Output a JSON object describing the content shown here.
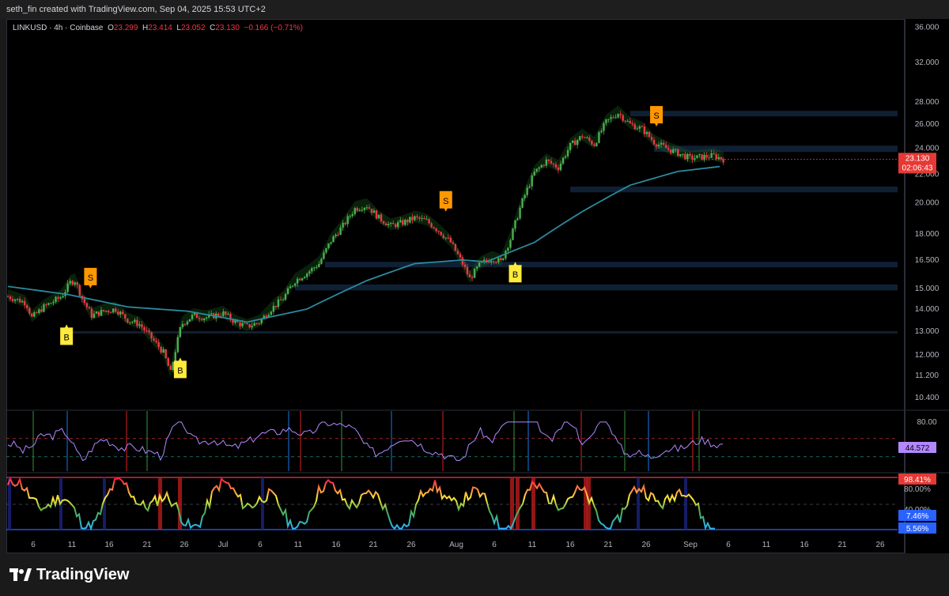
{
  "header": {
    "attribution": "seth_fin created with TradingView.com, Sep 04, 2025 15:53 UTC+2"
  },
  "legend": {
    "symbol": "LINKUSD · 4h · Coinbase",
    "o_label": "O",
    "o_value": "23.299",
    "h_label": "H",
    "h_value": "23.414",
    "l_label": "L",
    "l_value": "23.052",
    "c_label": "C",
    "c_value": "23.130",
    "change": "−0.166 (−0.71%)"
  },
  "price_badge": {
    "price": "23.130",
    "countdown": "02:06:43"
  },
  "rsi_badge": "44.572",
  "osc_badges": [
    "98.41%",
    "7.46%",
    "5.56%"
  ],
  "footer": {
    "brand": "TradingView"
  },
  "colors": {
    "up": "#26a69a",
    "up_bright": "#4caf50",
    "down": "#f23645",
    "ema": "#2b8a9e",
    "buy_badge": "#ffeb3b",
    "sell_badge": "#ff9800",
    "rsi": "#b388ff",
    "zone": "#1e3a5f"
  },
  "chart_data": {
    "type": "candlestick",
    "symbol": "LINKUSD",
    "timeframe": "4h",
    "exchange": "Coinbase",
    "price_axis": {
      "scale": "log",
      "ticks": [
        "36.000",
        "32.000",
        "28.000",
        "26.000",
        "24.000",
        "22.000",
        "20.000",
        "18.000",
        "16.500",
        "15.000",
        "14.000",
        "13.000",
        "12.000",
        "11.200",
        "10.400"
      ]
    },
    "x_ticks": [
      "6",
      "11",
      "16",
      "21",
      "26",
      "Jul",
      "6",
      "11",
      "16",
      "21",
      "26",
      "Aug",
      "6",
      "11",
      "16",
      "21",
      "26",
      "Sep",
      "6",
      "11",
      "16",
      "21",
      "26"
    ],
    "price_path": [
      [
        0,
        14.6
      ],
      [
        1.5,
        14.3
      ],
      [
        2,
        13.6
      ],
      [
        3,
        14.1
      ],
      [
        4.5,
        14.6
      ],
      [
        5.2,
        15.3
      ],
      [
        5.6,
        15.4
      ],
      [
        6.2,
        14.5
      ],
      [
        7,
        13.7
      ],
      [
        8,
        13.9
      ],
      [
        9,
        14.0
      ],
      [
        10,
        13.5
      ],
      [
        11,
        13.3
      ],
      [
        12,
        12.7
      ],
      [
        13,
        12.1
      ],
      [
        13.6,
        11.3
      ],
      [
        14.5,
        13.3
      ],
      [
        15.5,
        13.7
      ],
      [
        16.5,
        13.6
      ],
      [
        18,
        13.8
      ],
      [
        19,
        13.4
      ],
      [
        20,
        13.2
      ],
      [
        21,
        13.4
      ],
      [
        22,
        14.0
      ],
      [
        23,
        14.5
      ],
      [
        24,
        15.4
      ],
      [
        25,
        15.8
      ],
      [
        26,
        16.3
      ],
      [
        27,
        17.6
      ],
      [
        28,
        18.5
      ],
      [
        29,
        19.6
      ],
      [
        30,
        19.8
      ],
      [
        31,
        19.0
      ],
      [
        32,
        18.5
      ],
      [
        33,
        18.7
      ],
      [
        34,
        19.0
      ],
      [
        35,
        18.8
      ],
      [
        36,
        18.2
      ],
      [
        37,
        17.5
      ],
      [
        38,
        16.3
      ],
      [
        38.6,
        15.5
      ],
      [
        39.5,
        16.3
      ],
      [
        40.5,
        16.6
      ],
      [
        41.2,
        16.4
      ],
      [
        42,
        17.7
      ],
      [
        43,
        20.1
      ],
      [
        44,
        22.1
      ],
      [
        45,
        23.0
      ],
      [
        46,
        22.5
      ],
      [
        47,
        24.2
      ],
      [
        48,
        25.0
      ],
      [
        49,
        24.3
      ],
      [
        50,
        26.2
      ],
      [
        51,
        27.0
      ],
      [
        52,
        26.0
      ],
      [
        53,
        25.6
      ],
      [
        54,
        24.5
      ],
      [
        55,
        24.0
      ],
      [
        56,
        23.6
      ],
      [
        57,
        23.2
      ],
      [
        58,
        23.3
      ],
      [
        59,
        23.4
      ],
      [
        59.8,
        23.13
      ]
    ],
    "ema_path": [
      [
        0,
        15.1
      ],
      [
        5,
        14.7
      ],
      [
        10,
        14.1
      ],
      [
        15,
        13.9
      ],
      [
        20,
        13.4
      ],
      [
        25,
        14.0
      ],
      [
        30,
        15.4
      ],
      [
        34,
        16.3
      ],
      [
        38,
        16.5
      ],
      [
        40,
        16.4
      ],
      [
        44,
        17.5
      ],
      [
        48,
        19.4
      ],
      [
        52,
        21.2
      ],
      [
        56,
        22.2
      ],
      [
        59.8,
        22.6
      ]
    ],
    "signals": [
      {
        "label": "B",
        "at": 4.9,
        "price": 13.3,
        "type": "buy"
      },
      {
        "label": "S",
        "at": 6.9,
        "price": 15.0,
        "type": "sell"
      },
      {
        "label": "B",
        "at": 14.4,
        "price": 11.9,
        "type": "buy"
      },
      {
        "label": "S",
        "at": 36.6,
        "price": 19.4,
        "type": "sell"
      },
      {
        "label": "B",
        "at": 42.4,
        "price": 16.4,
        "type": "buy"
      },
      {
        "label": "S",
        "at": 54.2,
        "price": 25.8,
        "type": "sell"
      }
    ],
    "zones": [
      {
        "from": 4.4,
        "to": 75,
        "top": 13.0,
        "bottom": 12.9
      },
      {
        "from": 24.0,
        "to": 75,
        "top": 15.2,
        "bottom": 14.9
      },
      {
        "from": 26.5,
        "to": 75,
        "top": 16.4,
        "bottom": 16.1
      },
      {
        "from": 47.0,
        "to": 75,
        "top": 21.1,
        "bottom": 20.7
      },
      {
        "from": 52.0,
        "to": 75,
        "top": 27.2,
        "bottom": 26.7
      },
      {
        "from": 54.0,
        "to": 75,
        "top": 24.2,
        "bottom": 23.7
      }
    ],
    "rsi": {
      "upper_band": "80.00",
      "current": 44.572
    },
    "oscillator": {
      "levels": [
        "98.41%",
        "80.00%",
        "40.00%"
      ],
      "values": [
        "7.46%",
        "5.56%"
      ]
    }
  }
}
